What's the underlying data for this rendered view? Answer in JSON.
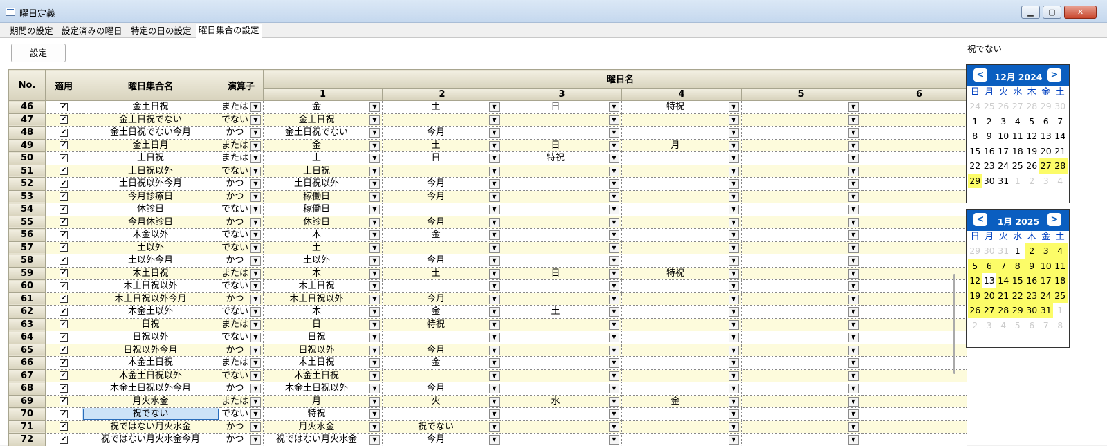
{
  "window": {
    "title": "曜日定義"
  },
  "tabs": [
    "期間の設定",
    "設定済みの曜日",
    "特定の日の設定",
    "曜日集合の設定"
  ],
  "toolbar": {
    "settings_button": "設定"
  },
  "grid": {
    "header": {
      "no": "No.",
      "apply": "適用",
      "set_name": "曜日集合名",
      "operator": "演算子",
      "day_names": "曜日名",
      "day_cols": [
        "1",
        "2",
        "3",
        "4",
        "5",
        "6"
      ]
    },
    "rows": [
      {
        "no": "46",
        "name": "金土日祝",
        "op": "または",
        "d": [
          "金",
          "土",
          "日",
          "特祝",
          ""
        ]
      },
      {
        "no": "47",
        "name": "金土日祝でない",
        "op": "でない",
        "d": [
          "金土日祝",
          "",
          "",
          "",
          ""
        ]
      },
      {
        "no": "48",
        "name": "金土日祝でない今月",
        "op": "かつ",
        "d": [
          "金土日祝でない",
          "今月",
          "",
          "",
          ""
        ]
      },
      {
        "no": "49",
        "name": "金土日月",
        "op": "または",
        "d": [
          "金",
          "土",
          "日",
          "月",
          ""
        ]
      },
      {
        "no": "50",
        "name": "土日祝",
        "op": "または",
        "d": [
          "土",
          "日",
          "特祝",
          "",
          ""
        ]
      },
      {
        "no": "51",
        "name": "土日祝以外",
        "op": "でない",
        "d": [
          "土日祝",
          "",
          "",
          "",
          ""
        ]
      },
      {
        "no": "52",
        "name": "土日祝以外今月",
        "op": "かつ",
        "d": [
          "土日祝以外",
          "今月",
          "",
          "",
          ""
        ]
      },
      {
        "no": "53",
        "name": "今月診療日",
        "op": "かつ",
        "d": [
          "稼働日",
          "今月",
          "",
          "",
          ""
        ]
      },
      {
        "no": "54",
        "name": "休診日",
        "op": "でない",
        "d": [
          "稼働日",
          "",
          "",
          "",
          ""
        ]
      },
      {
        "no": "55",
        "name": "今月休診日",
        "op": "かつ",
        "d": [
          "休診日",
          "今月",
          "",
          "",
          ""
        ]
      },
      {
        "no": "56",
        "name": "木金以外",
        "op": "でない",
        "d": [
          "木",
          "金",
          "",
          "",
          ""
        ]
      },
      {
        "no": "57",
        "name": "土以外",
        "op": "でない",
        "d": [
          "土",
          "",
          "",
          "",
          ""
        ]
      },
      {
        "no": "58",
        "name": "土以外今月",
        "op": "かつ",
        "d": [
          "土以外",
          "今月",
          "",
          "",
          ""
        ]
      },
      {
        "no": "59",
        "name": "木土日祝",
        "op": "または",
        "d": [
          "木",
          "土",
          "日",
          "特祝",
          ""
        ]
      },
      {
        "no": "60",
        "name": "木土日祝以外",
        "op": "でない",
        "d": [
          "木土日祝",
          "",
          "",
          "",
          ""
        ]
      },
      {
        "no": "61",
        "name": "木土日祝以外今月",
        "op": "かつ",
        "d": [
          "木土日祝以外",
          "今月",
          "",
          "",
          ""
        ]
      },
      {
        "no": "62",
        "name": "木金土以外",
        "op": "でない",
        "d": [
          "木",
          "金",
          "土",
          "",
          ""
        ]
      },
      {
        "no": "63",
        "name": "日祝",
        "op": "または",
        "d": [
          "日",
          "特祝",
          "",
          "",
          ""
        ]
      },
      {
        "no": "64",
        "name": "日祝以外",
        "op": "でない",
        "d": [
          "日祝",
          "",
          "",
          "",
          ""
        ]
      },
      {
        "no": "65",
        "name": "日祝以外今月",
        "op": "かつ",
        "d": [
          "日祝以外",
          "今月",
          "",
          "",
          ""
        ]
      },
      {
        "no": "66",
        "name": "木金土日祝",
        "op": "または",
        "d": [
          "木土日祝",
          "金",
          "",
          "",
          ""
        ]
      },
      {
        "no": "67",
        "name": "木金土日祝以外",
        "op": "でない",
        "d": [
          "木金土日祝",
          "",
          "",
          "",
          ""
        ]
      },
      {
        "no": "68",
        "name": "木金土日祝以外今月",
        "op": "かつ",
        "d": [
          "木金土日祝以外",
          "今月",
          "",
          "",
          ""
        ]
      },
      {
        "no": "69",
        "name": "月火水金",
        "op": "または",
        "d": [
          "月",
          "火",
          "水",
          "金",
          ""
        ]
      },
      {
        "no": "70",
        "name": "祝でない",
        "op": "でない",
        "d": [
          "特祝",
          "",
          "",
          "",
          ""
        ]
      },
      {
        "no": "71",
        "name": "祝ではない月火水金",
        "op": "かつ",
        "d": [
          "月火水金",
          "祝でない",
          "",
          "",
          ""
        ]
      },
      {
        "no": "72",
        "name": "祝ではない月火水金今月",
        "op": "かつ",
        "d": [
          "祝ではない月火水金",
          "今月",
          "",
          "",
          ""
        ]
      }
    ]
  },
  "side": {
    "selected_label": "祝でない"
  },
  "calendars": [
    {
      "title": "12月 2024",
      "prev": "<",
      "next": ">",
      "dow": [
        "日",
        "月",
        "火",
        "水",
        "木",
        "金",
        "土"
      ],
      "days": [
        [
          "24",
          "o"
        ],
        [
          "25",
          "o"
        ],
        [
          "26",
          "o"
        ],
        [
          "27",
          "o"
        ],
        [
          "28",
          "o"
        ],
        [
          "29",
          "o"
        ],
        [
          "30",
          "o"
        ],
        [
          "1",
          ""
        ],
        [
          "2",
          ""
        ],
        [
          "3",
          ""
        ],
        [
          "4",
          ""
        ],
        [
          "5",
          ""
        ],
        [
          "6",
          ""
        ],
        [
          "7",
          ""
        ],
        [
          "8",
          ""
        ],
        [
          "9",
          ""
        ],
        [
          "10",
          ""
        ],
        [
          "11",
          ""
        ],
        [
          "12",
          ""
        ],
        [
          "13",
          ""
        ],
        [
          "14",
          ""
        ],
        [
          "15",
          ""
        ],
        [
          "16",
          ""
        ],
        [
          "17",
          ""
        ],
        [
          "18",
          ""
        ],
        [
          "19",
          ""
        ],
        [
          "20",
          ""
        ],
        [
          "21",
          ""
        ],
        [
          "22",
          ""
        ],
        [
          "23",
          ""
        ],
        [
          "24",
          ""
        ],
        [
          "25",
          ""
        ],
        [
          "26",
          ""
        ],
        [
          "27",
          "h"
        ],
        [
          "28",
          "h"
        ],
        [
          "29",
          "h"
        ],
        [
          "30",
          ""
        ],
        [
          "31",
          ""
        ],
        [
          "1",
          "o"
        ],
        [
          "2",
          "o"
        ],
        [
          "3",
          "o"
        ],
        [
          "4",
          "o"
        ]
      ]
    },
    {
      "title": "1月 2025",
      "prev": "<",
      "next": ">",
      "dow": [
        "日",
        "月",
        "火",
        "水",
        "木",
        "金",
        "土"
      ],
      "days": [
        [
          "29",
          "o"
        ],
        [
          "30",
          "o"
        ],
        [
          "31",
          "o"
        ],
        [
          "1",
          ""
        ],
        [
          "2",
          "h"
        ],
        [
          "3",
          "h"
        ],
        [
          "4",
          "h"
        ],
        [
          "5",
          "h"
        ],
        [
          "6",
          "h"
        ],
        [
          "7",
          "h"
        ],
        [
          "8",
          "h"
        ],
        [
          "9",
          "h"
        ],
        [
          "10",
          "h"
        ],
        [
          "11",
          "h"
        ],
        [
          "12",
          "h"
        ],
        [
          "13",
          ""
        ],
        [
          "14",
          "h"
        ],
        [
          "15",
          "h"
        ],
        [
          "16",
          "h"
        ],
        [
          "17",
          "h"
        ],
        [
          "18",
          "h"
        ],
        [
          "19",
          "h"
        ],
        [
          "20",
          "h"
        ],
        [
          "21",
          "h"
        ],
        [
          "22",
          "h"
        ],
        [
          "23",
          "h"
        ],
        [
          "24",
          "h"
        ],
        [
          "25",
          "h"
        ],
        [
          "26",
          "h"
        ],
        [
          "27",
          "h"
        ],
        [
          "28",
          "h"
        ],
        [
          "29",
          "h"
        ],
        [
          "30",
          "h"
        ],
        [
          "31",
          "h"
        ],
        [
          "1",
          "o"
        ],
        [
          "2",
          "o"
        ],
        [
          "3",
          "o"
        ],
        [
          "4",
          "o"
        ],
        [
          "5",
          "o"
        ],
        [
          "6",
          "o"
        ],
        [
          "7",
          "o"
        ],
        [
          "8",
          "o"
        ]
      ]
    }
  ]
}
